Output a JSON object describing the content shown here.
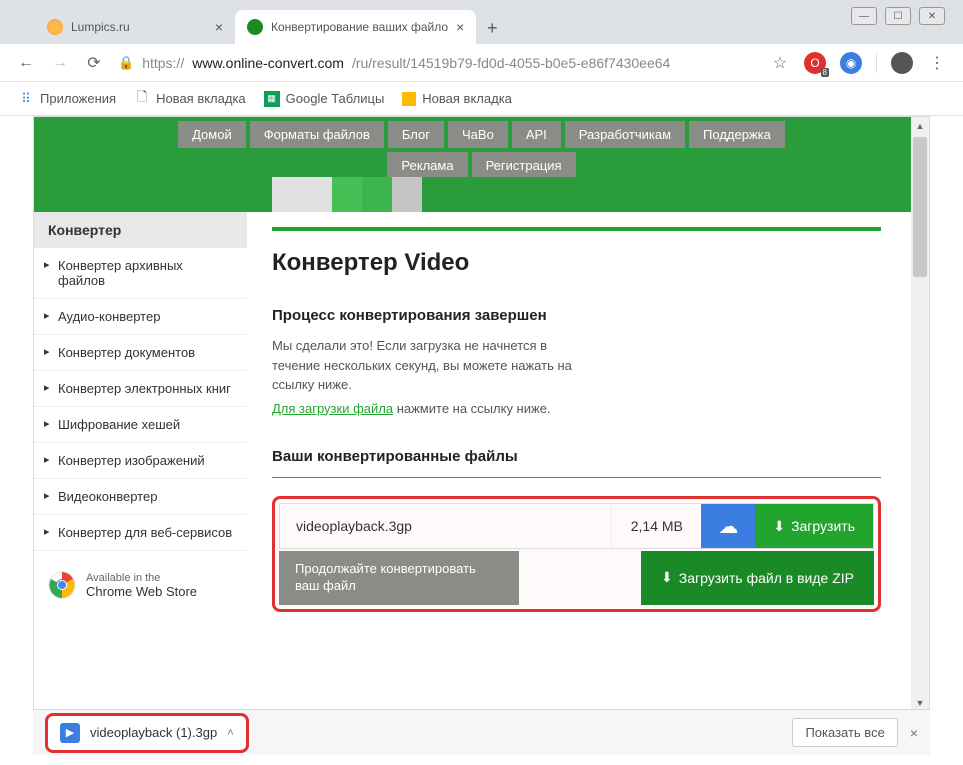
{
  "window": {
    "min": "—",
    "max": "☐",
    "close": "✕"
  },
  "tabs": [
    {
      "title": "Lumpics.ru",
      "active": false
    },
    {
      "title": "Конвертирование ваших файло",
      "active": true
    }
  ],
  "address": {
    "prefix": "https://",
    "host": "www.online-convert.com",
    "path": "/ru/result/14519b79-fd0d-4055-b0e5-e86f7430ee64"
  },
  "bookmarks": [
    {
      "label": "Приложения",
      "icon": "apps"
    },
    {
      "label": "Новая вкладка",
      "icon": "page"
    },
    {
      "label": "Google Таблицы",
      "icon": "sheets"
    },
    {
      "label": "Новая вкладка",
      "icon": "ytab"
    }
  ],
  "top_nav": {
    "row1": [
      "Домой",
      "Форматы файлов",
      "Блог",
      "ЧаВо",
      "API",
      "Разработчикам",
      "Поддержка"
    ],
    "row2": [
      "Реклама",
      "Регистрация"
    ]
  },
  "sidebar": {
    "header": "Конвертер",
    "items": [
      "Конвертер архивных файлов",
      "Аудио-конвертер",
      "Конвертер документов",
      "Конвертер электронных книг",
      "Шифрование хешей",
      "Конвертер изображений",
      "Видеоконвертер",
      "Конвертер для веб-сервисов"
    ],
    "webstore_top": "Available in the",
    "webstore_bottom": "Chrome Web Store"
  },
  "main": {
    "title": "Конвертер Video",
    "process_heading": "Процесс конвертирования завершен",
    "process_body": "Мы сделали это! Если загрузка не начнется в течение нескольких секунд, вы можете нажать на ссылку ниже.",
    "download_link": "Для загрузки файла",
    "download_link_tail": " нажмите на ссылку ниже.",
    "files_heading": "Ваши конвертированные файлы",
    "file": {
      "name": "videoplayback.3gp",
      "size": "2,14 MB"
    },
    "download_label": "Загрузить",
    "continue_label": "Продолжайте конвертировать ваш файл",
    "zip_label": "Загрузить файл в виде ZIP"
  },
  "download_bar": {
    "filename": "videoplayback (1).3gp",
    "show_all": "Показать все"
  }
}
